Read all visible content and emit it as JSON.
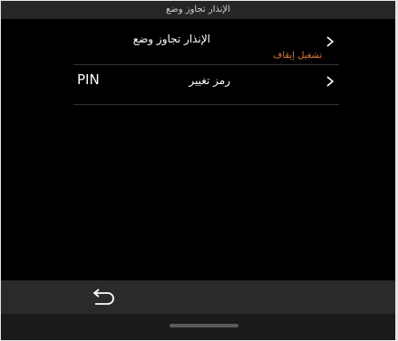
{
  "title": "الإنذار تجاوز وضع",
  "settings": [
    {
      "label": "الإنذار تجاوز وضع",
      "value": "تشغيل إيقاف",
      "icon": "chevron-right-icon"
    },
    {
      "label": "رمز تغيير",
      "prefix": "PIN",
      "icon": "chevron-right-icon"
    }
  ],
  "bottom_bar": {
    "back_icon": "back-arrow-icon"
  },
  "colors": {
    "accent": "#e0773a",
    "background": "#000000",
    "bar": "#262626"
  }
}
